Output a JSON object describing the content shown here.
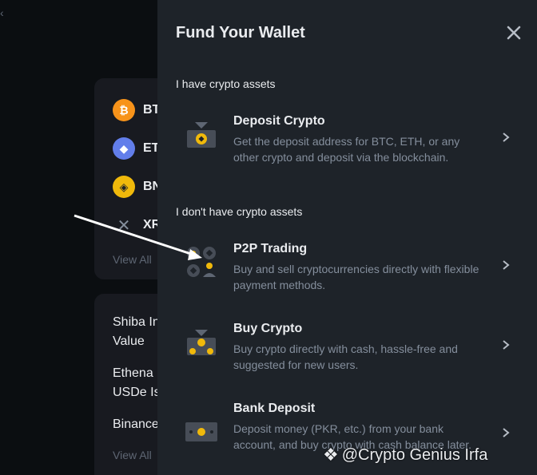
{
  "background": {
    "coins": [
      {
        "icon": "bitcoin-icon",
        "symbol": "BTC",
        "color": "#f7931a"
      },
      {
        "icon": "ethereum-icon",
        "symbol": "ETH",
        "color": "#627eea"
      },
      {
        "icon": "bnb-icon",
        "symbol": "BNB",
        "color": "#f0b90b"
      },
      {
        "icon": "xrp-icon",
        "symbol": "XRP",
        "color": "#23292f"
      }
    ],
    "view_all_1": "View All",
    "news": [
      "Shiba Inu\nValue",
      "Ethena\nUSDe Is",
      "Binance"
    ],
    "view_all_2": "View All"
  },
  "panel": {
    "title": "Fund Your Wallet",
    "section_have": "I have crypto assets",
    "section_dont": "I don't have crypto assets",
    "options": [
      {
        "title": "Deposit Crypto",
        "desc": "Get the deposit address for BTC, ETH, or any other crypto and deposit via the blockchain.",
        "icon": "deposit-crypto-icon"
      },
      {
        "title": "P2P Trading",
        "desc": "Buy and sell cryptocurrencies directly with flexible payment methods.",
        "icon": "p2p-trading-icon"
      },
      {
        "title": "Buy Crypto",
        "desc": "Buy crypto directly with cash, hassle-free and suggested for new users.",
        "icon": "buy-crypto-icon"
      },
      {
        "title": "Bank Deposit",
        "desc": "Deposit money (PKR, etc.) from your bank account, and buy crypto with cash balance later.",
        "icon": "bank-deposit-icon"
      }
    ]
  },
  "watermark": "@Crypto Genius Irfa",
  "colors": {
    "accent": "#f0b90b",
    "panel_bg": "#1e2329",
    "page_bg": "#0b0e11",
    "text_primary": "#eaecef",
    "text_secondary": "#848e9c"
  }
}
